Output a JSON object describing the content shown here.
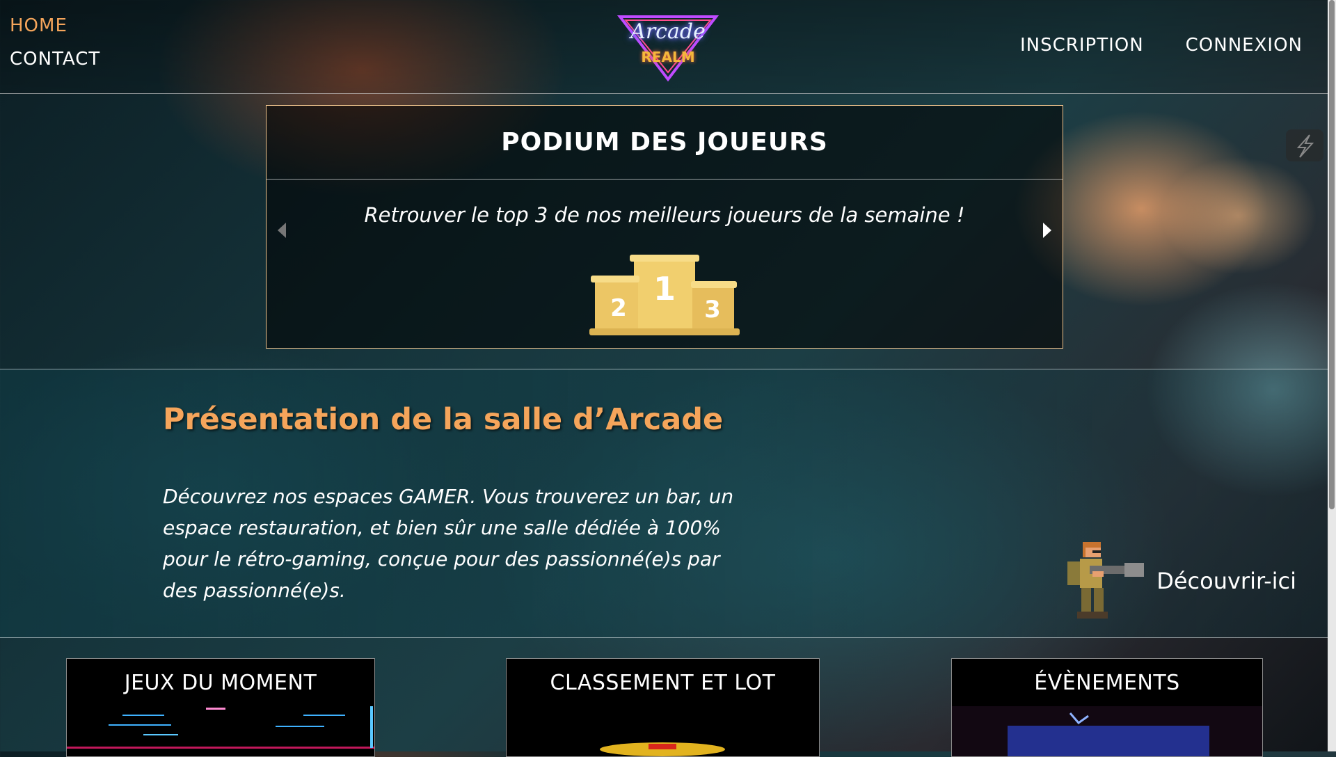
{
  "nav": {
    "home": "HOME",
    "contact": "CONTACT",
    "inscription": "INSCRIPTION",
    "connexion": "CONNEXION"
  },
  "logo": {
    "script": "Arcade",
    "brand": "REALM"
  },
  "podium": {
    "title": "PODIUM DES JOUEURS",
    "subtitle": "Retrouver le top 3 de nos meilleurs joueurs de la semaine !",
    "places": [
      "2",
      "1",
      "3"
    ]
  },
  "presentation": {
    "title": "Présentation de la salle d’Arcade",
    "text": "Découvrez nos espaces GAMER. Vous trouverez un bar, un espace restauration, et bien sûr une salle dédiée à 100% pour le rétro-gaming, conçue pour des passionné(e)s par des passionné(e)s.",
    "cta": "Découvrir-ici"
  },
  "cards": [
    {
      "title": "JEUX DU MOMENT"
    },
    {
      "title": "CLASSEMENT ET LOT"
    },
    {
      "title": "ÉVÈNEMENTS"
    }
  ],
  "colors": {
    "accent": "#f5a55b",
    "border": "#f2c68f",
    "podium_gold": "#f1cf6e"
  }
}
